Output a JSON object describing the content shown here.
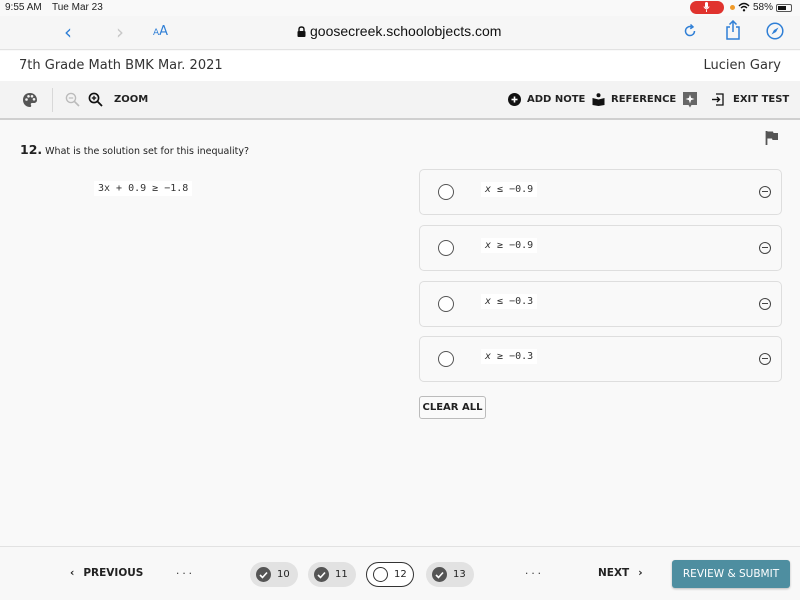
{
  "status_bar": {
    "time": "9:55 AM",
    "date": "Tue Mar 23",
    "battery": "58%"
  },
  "browser": {
    "text_size_label": "AA",
    "url": "goosecreek.schoolobjects.com"
  },
  "test_header": {
    "title": "7th Grade Math BMK Mar. 2021",
    "user": "Lucien Gary"
  },
  "toolbar": {
    "zoom_label": "ZOOM",
    "add_note_label": "ADD NOTE",
    "reference_label": "REFERENCE",
    "exit_label": "EXIT TEST"
  },
  "question": {
    "number": "12.",
    "prompt": "What is the solution set for this inequality?",
    "equation": "3x + 0.9 ≥ −1.8",
    "choices": [
      {
        "var": "x",
        "rest": " ≤ −0.9",
        "selected": false
      },
      {
        "var": "x",
        "rest": " ≥ −0.9",
        "selected": false
      },
      {
        "var": "x",
        "rest": " ≤ −0.3",
        "selected": false
      },
      {
        "var": "x",
        "rest": " ≥ −0.3",
        "selected": false
      }
    ],
    "clear_all_label": "CLEAR ALL"
  },
  "footer": {
    "previous_label": "PREVIOUS",
    "next_label": "NEXT",
    "ellipsis": "...",
    "pages": [
      {
        "number": "10",
        "state": "answered"
      },
      {
        "number": "11",
        "state": "answered"
      },
      {
        "number": "12",
        "state": "current"
      },
      {
        "number": "13",
        "state": "answered"
      }
    ],
    "submit_label": "REVIEW & SUBMIT"
  },
  "colors": {
    "browser_accent": "#2f7fd6",
    "submit_button": "#4e8ea0",
    "recording_indicator": "#e0332e"
  }
}
